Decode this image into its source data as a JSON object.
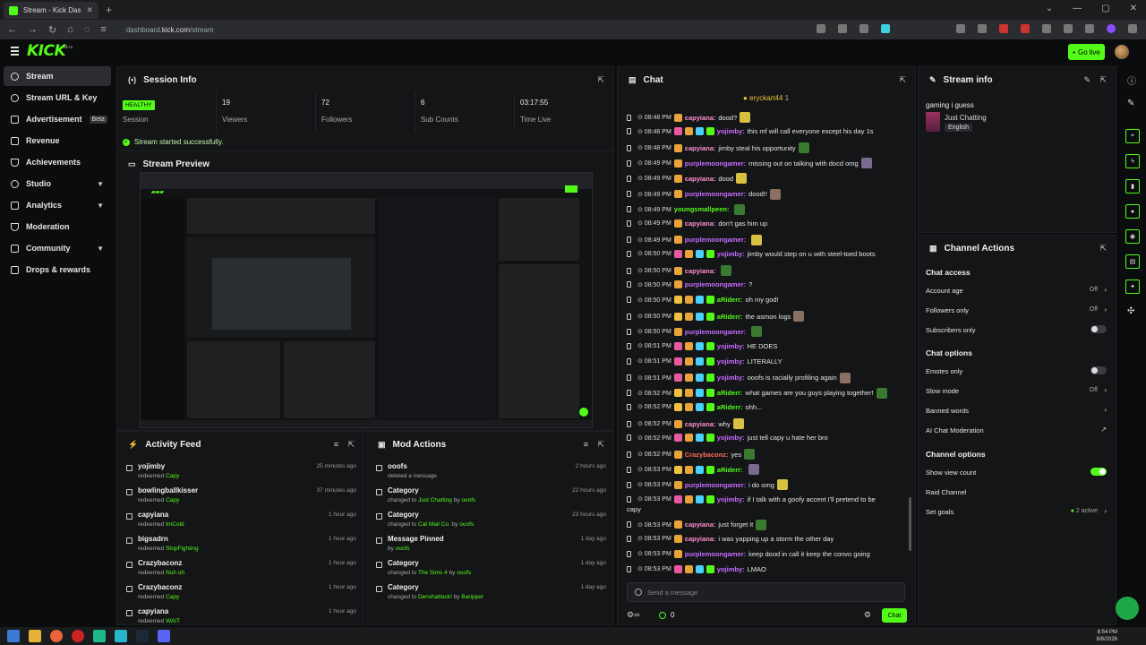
{
  "browser": {
    "tab_title": "Stream - Kick Dashboard",
    "url_prefix": "dashboard.",
    "url_domain": "kick.com",
    "url_path": "/stream"
  },
  "topbar": {
    "logo": "KICK",
    "logo_tag": "BETA",
    "go_live": "Go live"
  },
  "sidebar": {
    "items": [
      {
        "label": "Stream",
        "icon": "broadcast-icon"
      },
      {
        "label": "Stream URL & Key",
        "icon": "link-icon"
      },
      {
        "label": "Advertisement",
        "badge": "Beta",
        "icon": "ad-icon"
      },
      {
        "label": "Revenue",
        "icon": "revenue-icon"
      },
      {
        "label": "Achievements",
        "icon": "trophy-icon"
      },
      {
        "label": "Studio",
        "icon": "studio-icon"
      },
      {
        "label": "Analytics",
        "icon": "analytics-icon"
      },
      {
        "label": "Moderation",
        "icon": "shield-icon"
      },
      {
        "label": "Community",
        "icon": "community-icon"
      },
      {
        "label": "Drops & rewards",
        "icon": "gift-icon"
      }
    ]
  },
  "session": {
    "title": "Session Info",
    "status": "HEALTHY",
    "status_label": "Session",
    "viewers": "19",
    "viewers_label": "Viewers",
    "followers": "72",
    "followers_label": "Followers",
    "subs": "6",
    "subs_label": "Sub Counts",
    "time": "03:17:55",
    "time_label": "Time Live",
    "message": "Stream started successfully."
  },
  "preview": {
    "title": "Stream Preview"
  },
  "activity": {
    "title": "Activity Feed",
    "rows": [
      {
        "name": "yojimby",
        "action": "redeemed ",
        "reward": "Capy",
        "time": "25 minutes ago"
      },
      {
        "name": "bowlingballkisser",
        "action": "redeemed ",
        "reward": "Capy",
        "time": "37 minutes ago"
      },
      {
        "name": "capyiana",
        "action": "redeemed ",
        "reward": "ImCold",
        "time": "1 hour ago"
      },
      {
        "name": "bigsadrn",
        "action": "redeemed ",
        "reward": "StopFighting",
        "time": "1 hour ago"
      },
      {
        "name": "Crazybaconz",
        "action": "redeemed ",
        "reward": "Nuh uh",
        "time": "1 hour ago"
      },
      {
        "name": "Crazybaconz",
        "action": "redeemed ",
        "reward": "Capy",
        "time": "1 hour ago"
      },
      {
        "name": "capyiana",
        "action": "redeemed ",
        "reward": "WAIT",
        "time": "1 hour ago"
      }
    ]
  },
  "mod": {
    "title": "Mod Actions",
    "rows": [
      {
        "name": "ooofs",
        "sub1": "deleted a message",
        "hl": "",
        "sub2": "",
        "hl2": "",
        "time": "2 hours ago"
      },
      {
        "name": "Category",
        "sub1": "changed to ",
        "hl": "Just Chatting",
        "sub2": " by ",
        "hl2": "ooofs",
        "time": "22 hours ago"
      },
      {
        "name": "Category",
        "sub1": "changed to ",
        "hl": "Cat Mail Co.",
        "sub2": " by ",
        "hl2": "ooofs",
        "time": "23 hours ago"
      },
      {
        "name": "Message Pinned",
        "sub1": "by ",
        "hl": "ooofs",
        "sub2": "",
        "hl2": "",
        "time": "1 day ago"
      },
      {
        "name": "Category",
        "sub1": "changed to ",
        "hl": "The Sims 4",
        "sub2": " by ",
        "hl2": "ooofs",
        "time": "1 day ago"
      },
      {
        "name": "Category",
        "sub1": "changed to ",
        "hl": "Denshattack!",
        "sub2": " by ",
        "hl2": "Baripper",
        "time": "1 day ago"
      }
    ]
  },
  "chat": {
    "title": "Chat",
    "pinned_user": "eryckart44",
    "pinned_count": "1",
    "messages": [
      {
        "time": "08:48 PM",
        "user": "capyiana",
        "color": "#ff8fcf",
        "text": "dood?",
        "badges": [
          "#e8a33a"
        ],
        "emote": true
      },
      {
        "time": "08:48 PM",
        "user": "yojimby",
        "color": "#c86cff",
        "text": "this mf will call everyone except his day 1s",
        "badges": [
          "#e85aa0",
          "#e8a33a",
          "#4ad0ff",
          "#53fc18"
        ],
        "emote": false
      },
      {
        "time": "08:48 PM",
        "user": "capyiana",
        "color": "#ff8fcf",
        "text": "jimby steal his opportunity",
        "badges": [
          "#e8a33a"
        ],
        "emote": true
      },
      {
        "time": "08:49 PM",
        "user": "purplemoongamer",
        "color": "#c86cff",
        "text": "missing out on talking with docd omg",
        "badges": [
          "#e8a33a"
        ],
        "emote": true
      },
      {
        "time": "08:49 PM",
        "user": "capyiana",
        "color": "#ff8fcf",
        "text": "dood",
        "badges": [
          "#e8a33a"
        ],
        "emote": true
      },
      {
        "time": "08:49 PM",
        "user": "purplemoongamer",
        "color": "#c86cff",
        "text": "dood!!",
        "badges": [
          "#e8a33a"
        ],
        "emote": true
      },
      {
        "time": "08:49 PM",
        "user": "youngsmallpeen",
        "color": "#53fc18",
        "text": "",
        "badges": [],
        "emote": true
      },
      {
        "time": "08:49 PM",
        "user": "capyiana",
        "color": "#ff8fcf",
        "text": "don't gas him up",
        "badges": [
          "#e8a33a"
        ],
        "emote": false
      },
      {
        "time": "08:49 PM",
        "user": "purplemoongamer",
        "color": "#c86cff",
        "text": "",
        "badges": [
          "#e8a33a"
        ],
        "emote": true
      },
      {
        "time": "08:50 PM",
        "user": "yojimby",
        "color": "#c86cff",
        "text": "jimby would step on u with steel-toed boots",
        "badges": [
          "#e85aa0",
          "#e8a33a",
          "#4ad0ff",
          "#53fc18"
        ],
        "emote": false
      },
      {
        "time": "08:50 PM",
        "user": "capyiana",
        "color": "#ff8fcf",
        "text": "",
        "badges": [
          "#e8a33a"
        ],
        "emote": true
      },
      {
        "time": "08:50 PM",
        "user": "purplemoongamer",
        "color": "#c86cff",
        "text": "?",
        "badges": [
          "#e8a33a"
        ],
        "emote": false
      },
      {
        "time": "08:50 PM",
        "user": "aRiderr",
        "color": "#53fc18",
        "text": "oh my god!",
        "badges": [
          "#f0c040",
          "#e8a33a",
          "#4ad0ff",
          "#53fc18"
        ],
        "emote": false
      },
      {
        "time": "08:50 PM",
        "user": "aRiderr",
        "color": "#53fc18",
        "text": "the asmon logs",
        "badges": [
          "#f0c040",
          "#e8a33a",
          "#4ad0ff",
          "#53fc18"
        ],
        "emote": true
      },
      {
        "time": "08:50 PM",
        "user": "purplemoongamer",
        "color": "#c86cff",
        "text": "",
        "badges": [
          "#e8a33a"
        ],
        "emote": true
      },
      {
        "time": "08:51 PM",
        "user": "yojimby",
        "color": "#c86cff",
        "text": "HE DOES",
        "badges": [
          "#e85aa0",
          "#e8a33a",
          "#4ad0ff",
          "#53fc18"
        ],
        "emote": false
      },
      {
        "time": "08:51 PM",
        "user": "yojimby",
        "color": "#c86cff",
        "text": "LITERALLY",
        "badges": [
          "#e85aa0",
          "#e8a33a",
          "#4ad0ff",
          "#53fc18"
        ],
        "emote": false
      },
      {
        "time": "08:51 PM",
        "user": "yojimby",
        "color": "#c86cff",
        "text": "ooofs is racially profiling again",
        "badges": [
          "#e85aa0",
          "#e8a33a",
          "#4ad0ff",
          "#53fc18"
        ],
        "emote": true
      },
      {
        "time": "08:52 PM",
        "user": "aRiderr",
        "color": "#53fc18",
        "text": "what games are you guys playing together!",
        "badges": [
          "#f0c040",
          "#e8a33a",
          "#4ad0ff",
          "#53fc18"
        ],
        "emote": true
      },
      {
        "time": "08:52 PM",
        "user": "aRiderr",
        "color": "#53fc18",
        "text": "ohh...",
        "badges": [
          "#f0c040",
          "#e8a33a",
          "#4ad0ff",
          "#53fc18"
        ],
        "emote": false
      },
      {
        "time": "08:52 PM",
        "user": "capyiana",
        "color": "#ff8fcf",
        "text": "why",
        "badges": [
          "#e8a33a"
        ],
        "emote": true
      },
      {
        "time": "08:52 PM",
        "user": "yojimby",
        "color": "#c86cff",
        "text": "just tell capy u hate her bro",
        "badges": [
          "#e85aa0",
          "#e8a33a",
          "#4ad0ff",
          "#53fc18"
        ],
        "emote": false
      },
      {
        "time": "08:52 PM",
        "user": "Crazybaconz",
        "color": "#ff6a5a",
        "text": "yes",
        "badges": [
          "#e8a33a"
        ],
        "emote": true
      },
      {
        "time": "08:53 PM",
        "user": "aRiderr",
        "color": "#53fc18",
        "text": "",
        "badges": [
          "#f0c040",
          "#e8a33a",
          "#4ad0ff",
          "#53fc18"
        ],
        "emote": true
      },
      {
        "time": "08:53 PM",
        "user": "purplemoongamer",
        "color": "#c86cff",
        "text": "i do omg",
        "badges": [
          "#e8a33a"
        ],
        "emote": true
      },
      {
        "time": "08:53 PM",
        "user": "yojimby",
        "color": "#c86cff",
        "text": "if I talk with a goofy accent I'll pretend to be",
        "badges": [
          "#e85aa0",
          "#e8a33a",
          "#4ad0ff",
          "#53fc18"
        ],
        "emote": false
      },
      {
        "time": "08:53 PM",
        "user": "capyiana",
        "color": "#ff8fcf",
        "text": "just forget it",
        "badges": [
          "#e8a33a"
        ],
        "emote": true
      },
      {
        "time": "08:53 PM",
        "user": "capyiana",
        "color": "#ff8fcf",
        "text": "i was yapping up a storm the other day",
        "badges": [
          "#e8a33a"
        ],
        "emote": false
      },
      {
        "time": "08:53 PM",
        "user": "purplemoongamer",
        "color": "#c86cff",
        "text": "keep dood in call it keep the convo going",
        "badges": [
          "#e8a33a"
        ],
        "emote": false
      },
      {
        "time": "08:53 PM",
        "user": "yojimby",
        "color": "#c86cff",
        "text": "LMAO",
        "badges": [
          "#e85aa0",
          "#e8a33a",
          "#4ad0ff",
          "#53fc18"
        ],
        "emote": false
      }
    ],
    "wrap_text": "capy",
    "input_placeholder": "Send a message",
    "count": "0",
    "send": "Chat"
  },
  "streaminfo": {
    "title": "Stream info",
    "stream_title": "gaming i guess",
    "category": "Just Chatting",
    "language": "English"
  },
  "actions": {
    "title": "Channel Actions",
    "chat_access": "Chat access",
    "account_age": "Account age",
    "account_age_val": "Off",
    "followers_only": "Followers only",
    "followers_only_val": "Off",
    "subscribers_only": "Subscribers only",
    "chat_options": "Chat options",
    "emotes_only": "Emotes only",
    "slow_mode": "Slow mode",
    "slow_mode_val": "Off",
    "banned_words": "Banned words",
    "ai_mod": "AI Chat Moderation",
    "channel_options": "Channel options",
    "show_view_count": "Show view count",
    "raid_channel": "Raid Channel",
    "set_goals": "Set goals",
    "set_goals_val": "2 active"
  },
  "clock": {
    "time": "8:54 PM",
    "date": "8/8/2026"
  },
  "colors": {
    "accent": "#53fc18"
  }
}
